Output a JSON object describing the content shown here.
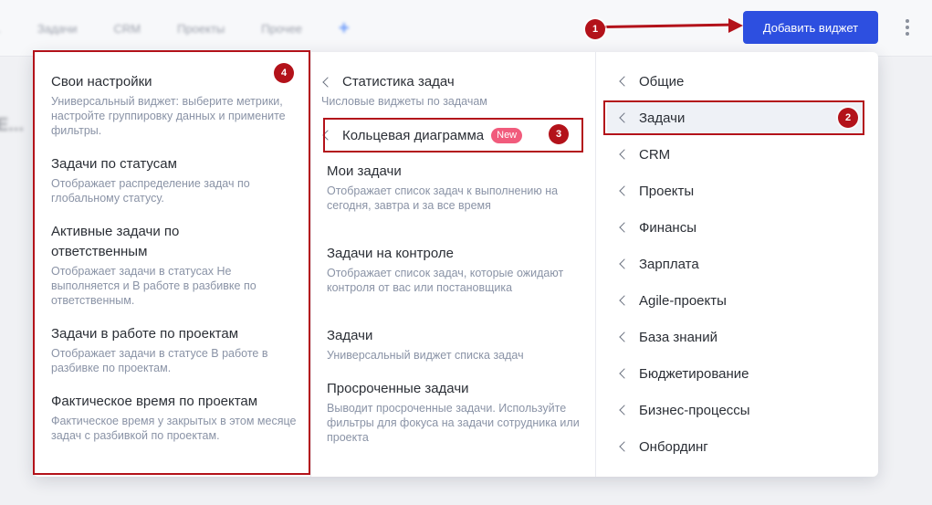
{
  "background": {
    "tabs": [
      "...",
      "Задачи",
      "CRM",
      "Проекты",
      "Прочее"
    ],
    "plus": "+",
    "page_title": "E..."
  },
  "header": {
    "add_widget_label": "Добавить виджет",
    "more_icon": "kebab-menu-icon"
  },
  "widgets_left": [
    {
      "title": "Свои настройки",
      "desc": "Универсальный виджет: выберите метрики, настройте группировку данных и примените фильтры."
    },
    {
      "title": "Задачи по статусам",
      "desc": "Отображает распределение задач по глобальному статусу."
    },
    {
      "title": "Активные задачи по ответственным",
      "desc": "Отображает задачи в статусах Не выполняется и В работе в разбивке по ответственным."
    },
    {
      "title": "Задачи в работе по проектам",
      "desc": "Отображает задачи в статусе В работе в разбивке по проектам."
    },
    {
      "title": "Фактическое время по проектам",
      "desc": "Фактическое время у закрытых в этом месяце задач с разбивкой по проектам."
    }
  ],
  "widgets_mid": {
    "stats": {
      "title": "Статистика задач",
      "desc": "Числовые виджеты по задачам"
    },
    "ring": {
      "title": "Кольцевая диаграмма",
      "badge": "New"
    },
    "items": [
      {
        "title": "Мои задачи",
        "desc": "Отображает список задач к выполнению на сегодня, завтра и за все время"
      },
      {
        "title": "Задачи на контроле",
        "desc": "Отображает список задач, которые ожидают контроля от вас или постановщика"
      },
      {
        "title": "Задачи",
        "desc": "Универсальный виджет списка задач"
      },
      {
        "title": "Просроченные задачи",
        "desc": "Выводит просроченные задачи. Используйте фильтры для фокуса на задачи сотрудника или проекта"
      }
    ]
  },
  "categories": [
    "Общие",
    "Задачи",
    "CRM",
    "Проекты",
    "Финансы",
    "Зарплата",
    "Agile-проекты",
    "База знаний",
    "Бюджетирование",
    "Бизнес-процессы",
    "Онбординг"
  ],
  "active_category": "Задачи",
  "annotations": [
    "1",
    "2",
    "3",
    "4"
  ],
  "colors": {
    "accent": "#2d4fe0",
    "annotation": "#b3121a",
    "badge_new": "#f15b7c"
  }
}
